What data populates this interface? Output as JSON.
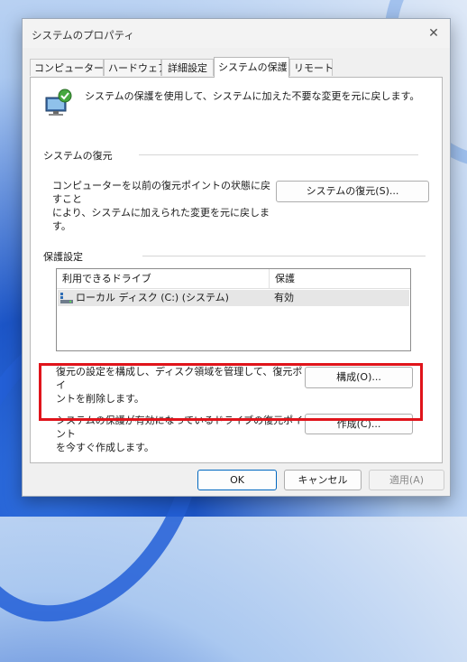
{
  "window": {
    "title": "システムのプロパティ"
  },
  "tabs": [
    {
      "label": "コンピューター名",
      "active": false
    },
    {
      "label": "ハードウェア",
      "active": false
    },
    {
      "label": "詳細設定",
      "active": false
    },
    {
      "label": "システムの保護",
      "active": true
    },
    {
      "label": "リモート",
      "active": false
    }
  ],
  "intro": {
    "text": "システムの保護を使用して、システムに加えた不要な変更を元に戻します。",
    "icon": "system-protection-icon"
  },
  "restore": {
    "group_title": "システムの復元",
    "description_line1": "コンピューターを以前の復元ポイントの状態に戻すこと",
    "description_line2": "により、システムに加えられた変更を元に戻します。",
    "button": "システムの復元(S)..."
  },
  "protection": {
    "group_title": "保護設定",
    "columns": [
      "利用できるドライブ",
      "保護"
    ],
    "drives": [
      {
        "name": "ローカル ディスク (C:) (システム)",
        "status": "有効",
        "icon": "drive-icon"
      }
    ],
    "configure_desc_line1": "復元の設定を構成し、ディスク領域を管理して、復元ポイ",
    "configure_desc_line2": "ントを削除します。",
    "configure_button": "構成(O)...",
    "create_desc_line1": "システムの保護が有効になっているドライブの復元ポイント",
    "create_desc_line2": "を今すぐ作成します。",
    "create_button": "作成(C)..."
  },
  "footer": {
    "ok": "OK",
    "cancel": "キャンセル",
    "apply": "適用(A)"
  },
  "colors": {
    "highlight": "#e0141b",
    "accent": "#0067c0"
  }
}
